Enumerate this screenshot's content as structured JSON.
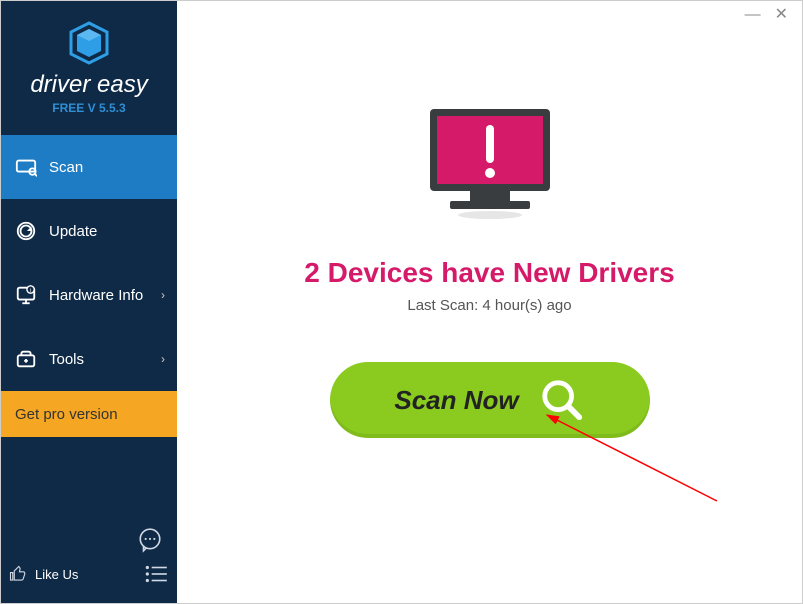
{
  "brand": {
    "name": "driver easy",
    "version_prefix": "FREE V ",
    "version": "5.5.3"
  },
  "sidebar": {
    "items": [
      {
        "label": "Scan",
        "has_chevron": false
      },
      {
        "label": "Update",
        "has_chevron": false
      },
      {
        "label": "Hardware Info",
        "has_chevron": true
      },
      {
        "label": "Tools",
        "has_chevron": true
      }
    ],
    "pro_label": "Get pro version",
    "like_us": "Like Us"
  },
  "main": {
    "headline": "2 Devices have New Drivers",
    "subline": "Last Scan: 4 hour(s) ago",
    "scan_button": "Scan Now"
  },
  "colors": {
    "accent_pink": "#d51a6a",
    "accent_green": "#8bcb1f",
    "accent_orange": "#f5a623",
    "sidebar_bg": "#0f2a47",
    "active_bg": "#1e7cc4"
  }
}
